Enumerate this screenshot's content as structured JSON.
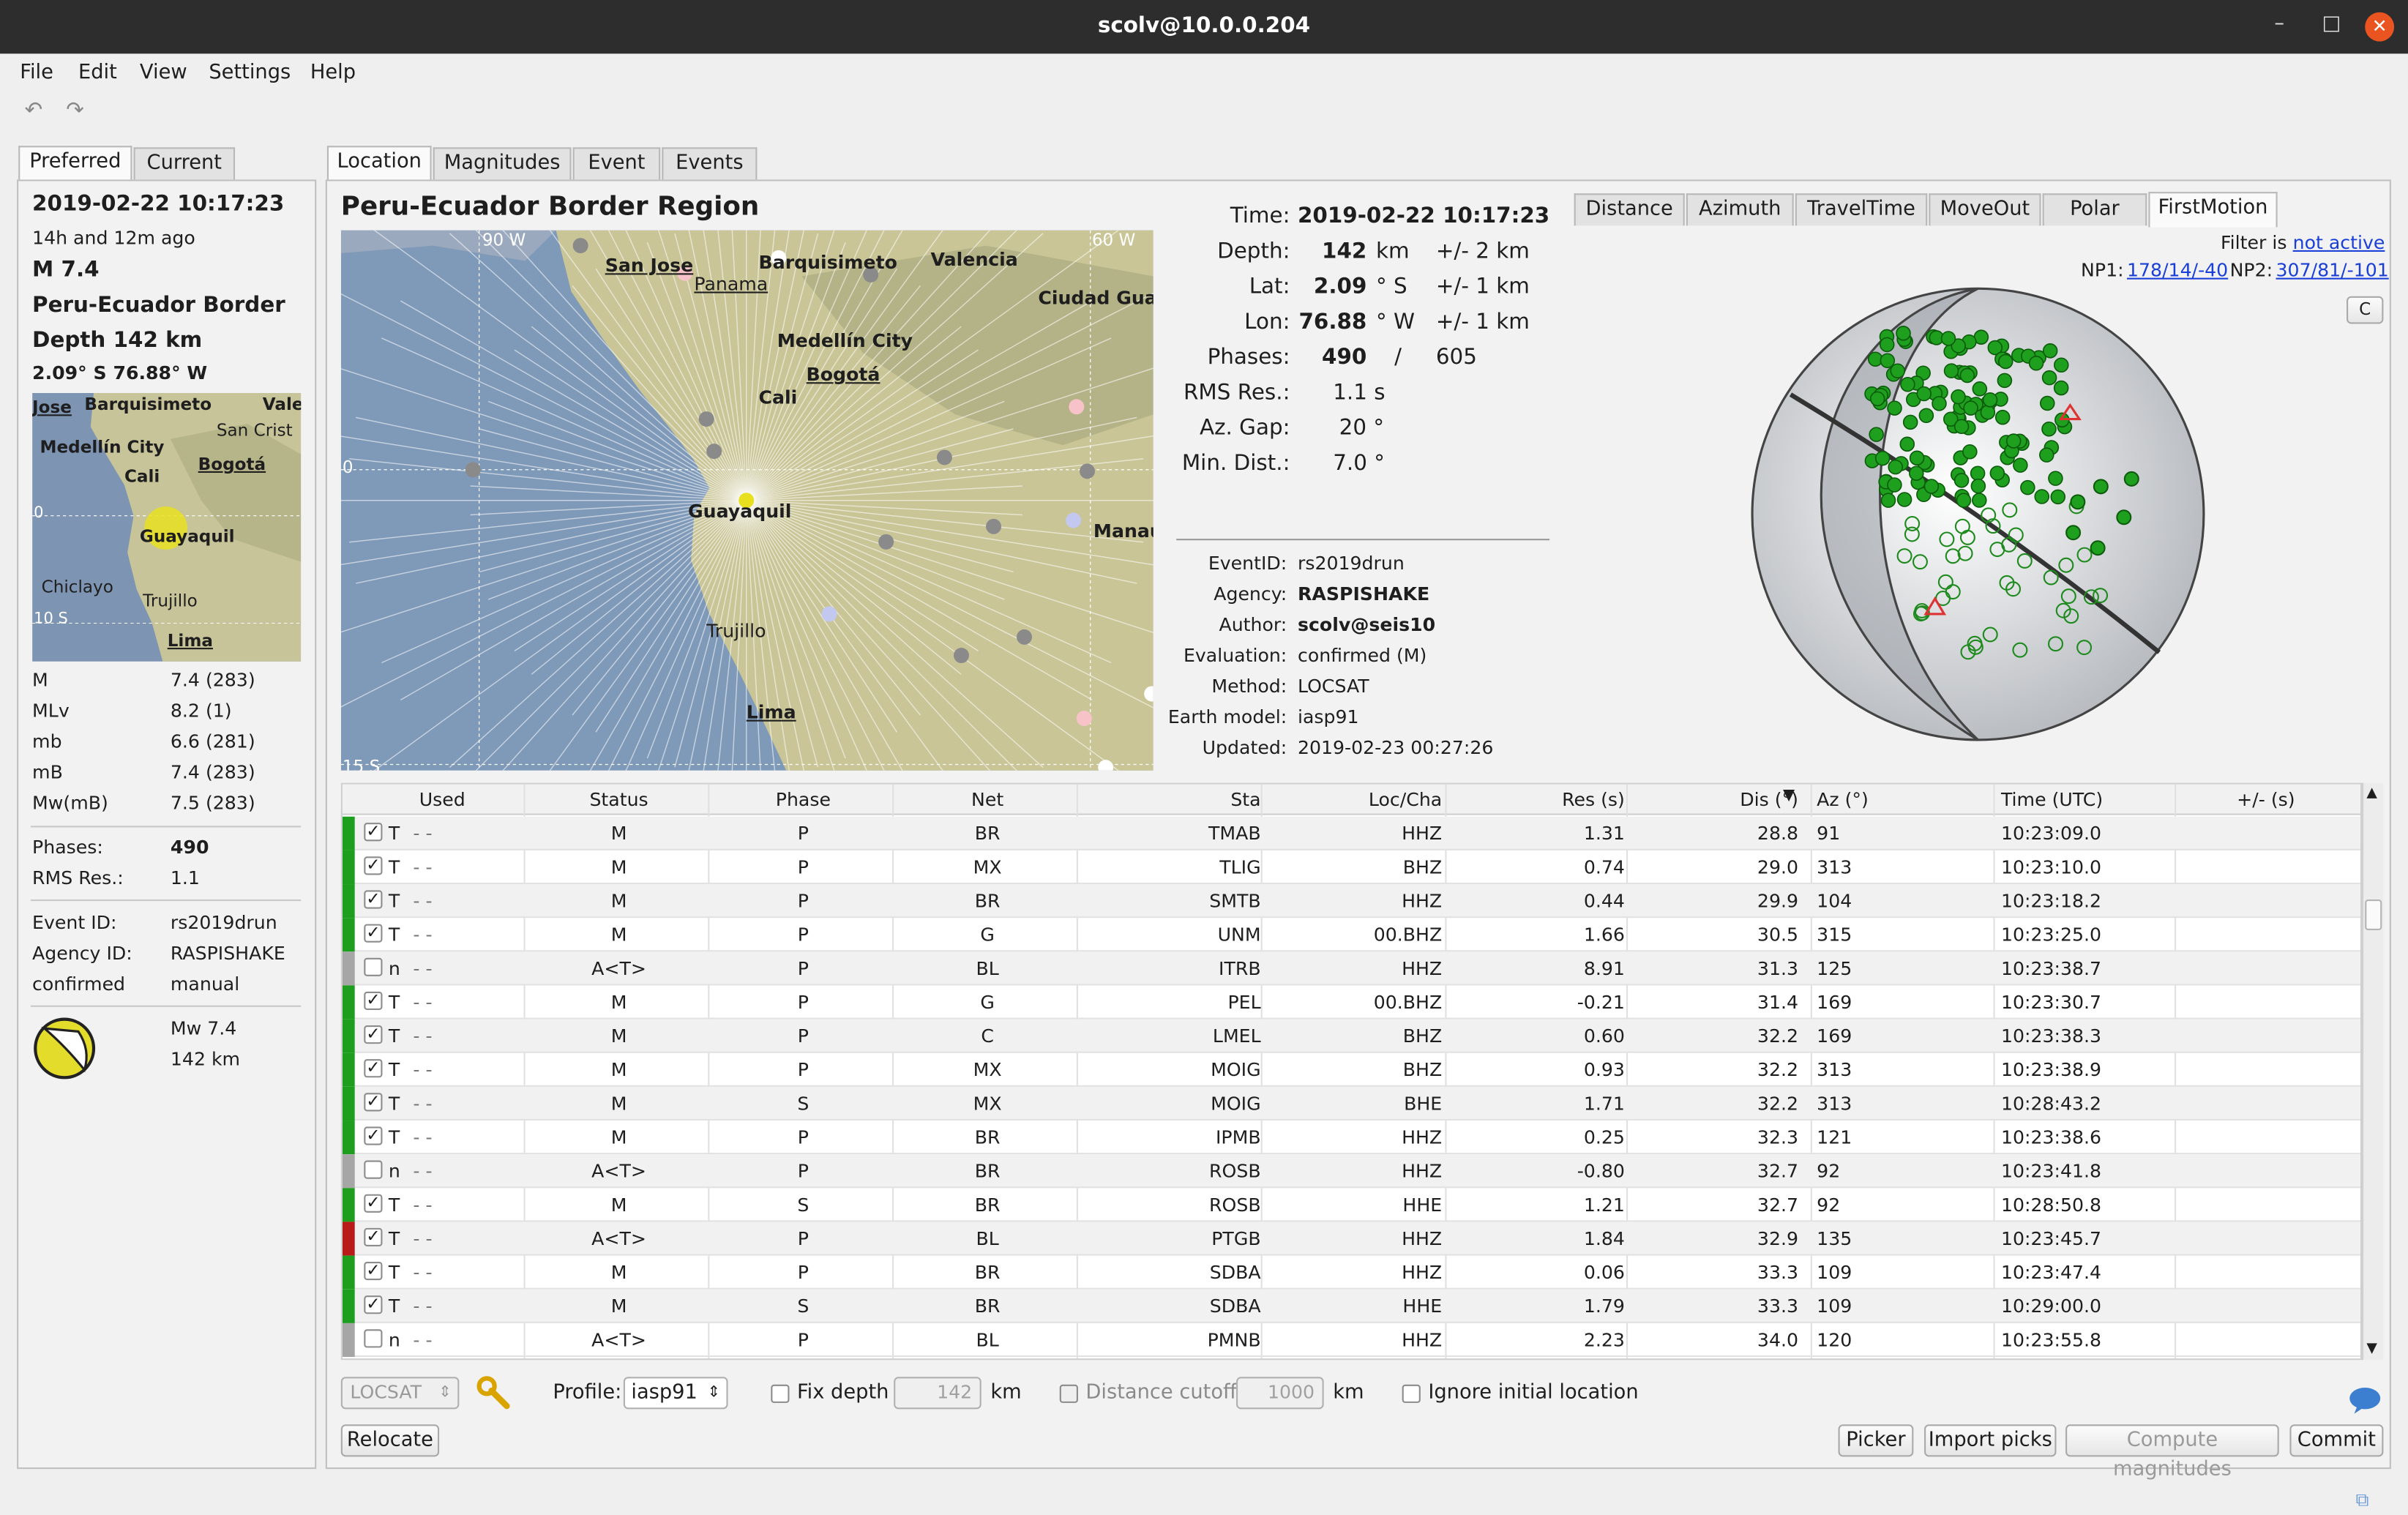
{
  "window": {
    "title": "scolv@10.0.0.204",
    "minimize": "–",
    "maximize": "□",
    "close": "✕"
  },
  "menu": [
    "File",
    "Edit",
    "View",
    "Settings",
    "Help"
  ],
  "toolbar": {
    "undo_icon": "↶",
    "redo_icon": "↷"
  },
  "left_tabs": [
    "Preferred",
    "Current"
  ],
  "summary": {
    "time": "2019-02-22 10:17:23",
    "ago": "14h and 12m ago",
    "mag": "M 7.4",
    "region": "Peru-Ecuador Border",
    "depth": "Depth 142 km",
    "latlon": "2.09° S  76.88° W",
    "magnitudes": [
      {
        "type": "M",
        "value": "7.4 (283)"
      },
      {
        "type": "MLv",
        "value": "8.2 (1)"
      },
      {
        "type": "mb",
        "value": "6.6 (281)"
      },
      {
        "type": "mB",
        "value": "7.4 (283)"
      },
      {
        "type": "Mw(mB)",
        "value": "7.5 (283)"
      }
    ],
    "phases_label": "Phases:",
    "phases": "490",
    "rms_label": "RMS Res.:",
    "rms": "1.1",
    "event_id_label": "Event ID:",
    "event_id": "rs2019drun",
    "agency_label": "Agency ID:",
    "agency": "RASPISHAKE",
    "status": "confirmed",
    "mode": "manual",
    "fm_mag": "Mw 7.4",
    "fm_depth": "142 km",
    "mini_map_labels": [
      "Jose",
      "Barquisimeto",
      "Vale",
      "San Crist",
      "Medellín City",
      "Bogotá",
      "Cali",
      "Guayaquil",
      "Chiclayo",
      "Trujillo",
      "Lima",
      "0",
      "10 S"
    ]
  },
  "main_tabs": [
    "Location",
    "Magnitudes",
    "Event",
    "Events"
  ],
  "region_title": "Peru-Ecuador Border Region",
  "map_labels": [
    "90 W",
    "60 W",
    "San Jose",
    "Panama",
    "Barquisimeto",
    "Valencia",
    "Ciudad Gua",
    "Medellín City",
    "Bogotá",
    "Cali",
    "Guayaquil",
    "Manau",
    "Trujillo",
    "Lima",
    "0",
    "15 S"
  ],
  "origin": {
    "time_label": "Time:",
    "time": "2019-02-22 10:17:23",
    "depth_label": "Depth:",
    "depth": "142",
    "depth_unit": "km",
    "depth_err": "+/- 2  km",
    "lat_label": "Lat:",
    "lat": "2.09",
    "lat_unit": "° S",
    "lat_err": "+/- 1  km",
    "lon_label": "Lon:",
    "lon": "76.88",
    "lon_unit": "° W",
    "lon_err": "+/- 1  km",
    "phases_label": "Phases:",
    "phases_used": "490",
    "phases_slash": "/",
    "phases_total": "605",
    "rms_label": "RMS Res.:",
    "rms": "1.1  s",
    "azgap_label": "Az. Gap:",
    "azgap": "20  °",
    "mindist_label": "Min. Dist.:",
    "mindist": "7.0  °"
  },
  "meta": [
    {
      "label": "EventID:",
      "value": "rs2019drun",
      "bold": false
    },
    {
      "label": "Agency:",
      "value": "RASPISHAKE",
      "bold": true
    },
    {
      "label": "Author:",
      "value": "scolv@seis10",
      "bold": true
    },
    {
      "label": "Evaluation:",
      "value": "confirmed (M)",
      "bold": false
    },
    {
      "label": "Method:",
      "value": "LOCSAT",
      "bold": false
    },
    {
      "label": "Earth model:",
      "value": "iasp91",
      "bold": false
    },
    {
      "label": "Updated:",
      "value": "2019-02-23 00:27:26",
      "bold": false
    }
  ],
  "plot_tabs": [
    "Distance",
    "Azimuth",
    "TravelTime",
    "MoveOut",
    "Polar",
    "FirstMotion"
  ],
  "firstmotion": {
    "filter_label": "Filter is",
    "filter_link": "not active",
    "np1_label": "NP1:",
    "np1": "178/14/-40",
    "np2_label": "NP2:",
    "np2": "307/81/-101",
    "corner_btn": "C"
  },
  "table": {
    "headers": [
      "Used",
      "Status",
      "Phase",
      "Net",
      "Sta",
      "Loc/Cha",
      "Res (s)",
      "Dis (°)",
      "Az (°)",
      "Time (UTC)",
      "+/- (s)"
    ],
    "rows": [
      {
        "c": "#1e9e1e",
        "u": true,
        "f": "T",
        "s": "M",
        "p": "P",
        "n": "BR",
        "st": "TMAB",
        "lc": "HHZ",
        "r": "1.31",
        "d": "28.8",
        "a": "91",
        "t": "10:23:09.0"
      },
      {
        "c": "#1e9e1e",
        "u": true,
        "f": "T",
        "s": "M",
        "p": "P",
        "n": "MX",
        "st": "TLIG",
        "lc": "BHZ",
        "r": "0.74",
        "d": "29.0",
        "a": "313",
        "t": "10:23:10.0"
      },
      {
        "c": "#1e9e1e",
        "u": true,
        "f": "T",
        "s": "M",
        "p": "P",
        "n": "BR",
        "st": "SMTB",
        "lc": "HHZ",
        "r": "0.44",
        "d": "29.9",
        "a": "104",
        "t": "10:23:18.2"
      },
      {
        "c": "#1e9e1e",
        "u": true,
        "f": "T",
        "s": "M",
        "p": "P",
        "n": "G",
        "st": "UNM",
        "lc": "00.BHZ",
        "r": "1.66",
        "d": "30.5",
        "a": "315",
        "t": "10:23:25.0"
      },
      {
        "c": "#a6a6a6",
        "u": false,
        "f": "n",
        "s": "A<T>",
        "p": "P",
        "n": "BL",
        "st": "ITRB",
        "lc": "HHZ",
        "r": "8.91",
        "d": "31.3",
        "a": "125",
        "t": "10:23:38.7"
      },
      {
        "c": "#1e9e1e",
        "u": true,
        "f": "T",
        "s": "M",
        "p": "P",
        "n": "G",
        "st": "PEL",
        "lc": "00.BHZ",
        "r": "-0.21",
        "d": "31.4",
        "a": "169",
        "t": "10:23:30.7"
      },
      {
        "c": "#1e9e1e",
        "u": true,
        "f": "T",
        "s": "M",
        "p": "P",
        "n": "C",
        "st": "LMEL",
        "lc": "BHZ",
        "r": "0.60",
        "d": "32.2",
        "a": "169",
        "t": "10:23:38.3"
      },
      {
        "c": "#1e9e1e",
        "u": true,
        "f": "T",
        "s": "M",
        "p": "P",
        "n": "MX",
        "st": "MOIG",
        "lc": "BHZ",
        "r": "0.93",
        "d": "32.2",
        "a": "313",
        "t": "10:23:38.9"
      },
      {
        "c": "#1e9e1e",
        "u": true,
        "f": "T",
        "s": "M",
        "p": "S",
        "n": "MX",
        "st": "MOIG",
        "lc": "BHE",
        "r": "1.71",
        "d": "32.2",
        "a": "313",
        "t": "10:28:43.2"
      },
      {
        "c": "#1e9e1e",
        "u": true,
        "f": "T",
        "s": "M",
        "p": "P",
        "n": "BR",
        "st": "IPMB",
        "lc": "HHZ",
        "r": "0.25",
        "d": "32.3",
        "a": "121",
        "t": "10:23:38.6"
      },
      {
        "c": "#a6a6a6",
        "u": false,
        "f": "n",
        "s": "A<T>",
        "p": "P",
        "n": "BR",
        "st": "ROSB",
        "lc": "HHZ",
        "r": "-0.80",
        "d": "32.7",
        "a": "92",
        "t": "10:23:41.8"
      },
      {
        "c": "#1e9e1e",
        "u": true,
        "f": "T",
        "s": "M",
        "p": "S",
        "n": "BR",
        "st": "ROSB",
        "lc": "HHE",
        "r": "1.21",
        "d": "32.7",
        "a": "92",
        "t": "10:28:50.8"
      },
      {
        "c": "#b81a1a",
        "u": true,
        "f": "T",
        "s": "A<T>",
        "p": "P",
        "n": "BL",
        "st": "PTGB",
        "lc": "HHZ",
        "r": "1.84",
        "d": "32.9",
        "a": "135",
        "t": "10:23:45.7"
      },
      {
        "c": "#1e9e1e",
        "u": true,
        "f": "T",
        "s": "M",
        "p": "P",
        "n": "BR",
        "st": "SDBA",
        "lc": "HHZ",
        "r": "0.06",
        "d": "33.3",
        "a": "109",
        "t": "10:23:47.4"
      },
      {
        "c": "#1e9e1e",
        "u": true,
        "f": "T",
        "s": "M",
        "p": "S",
        "n": "BR",
        "st": "SDBA",
        "lc": "HHE",
        "r": "1.79",
        "d": "33.3",
        "a": "109",
        "t": "10:29:00.0"
      },
      {
        "c": "#a6a6a6",
        "u": false,
        "f": "n",
        "s": "A<T>",
        "p": "P",
        "n": "BL",
        "st": "PMNB",
        "lc": "HHZ",
        "r": "2.23",
        "d": "34.0",
        "a": "120",
        "t": "10:23:55.8"
      }
    ]
  },
  "bottom": {
    "locator": "LOCSAT",
    "profile_label": "Profile:",
    "profile": "iasp91",
    "fix_depth": "Fix depth",
    "fix_depth_value": "142",
    "km1": "km",
    "distance_cutoff": "Distance cutoff",
    "distance_value": "1000",
    "km2": "km",
    "ignore_initial": "Ignore initial location",
    "relocate": "Relocate",
    "picker": "Picker",
    "import_picks": "Import picks",
    "compute_magnitudes": "Compute magnitudes",
    "commit": "Commit"
  },
  "colors": {
    "used": "#1e9e1e",
    "unused": "#a6a6a6",
    "warning": "#b81a1a",
    "link": "#1a3fd8"
  }
}
